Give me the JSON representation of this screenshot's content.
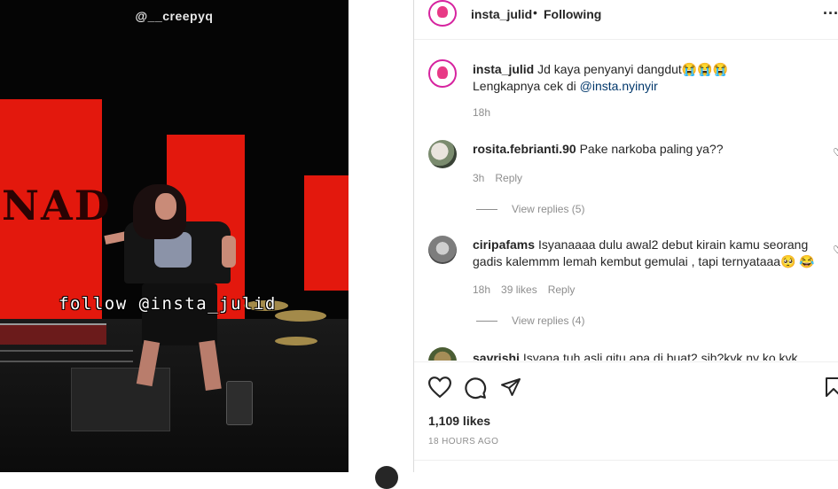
{
  "media": {
    "watermark_top": "@__creepyq",
    "watermark_mid": "follow @insta_julid",
    "banner_text": "NAD"
  },
  "post": {
    "username": "insta_julid",
    "separator": "•",
    "follow_status": "Following",
    "more_label": "..."
  },
  "caption": {
    "username": "insta_julid",
    "text": "Jd kaya penyanyi dangdut😭😭😭",
    "line2_prefix": "Lengkapnya cek di ",
    "mention": "@insta.nyinyir",
    "time": "18h"
  },
  "comments": [
    {
      "username": "rosita.febrianti.90",
      "text": "Pake narkoba paling ya??",
      "time": "3h",
      "reply": "Reply",
      "view_replies": "View replies (5)"
    },
    {
      "username": "ciripafams",
      "text": "Isyanaaaa dulu awal2 debut kirain kamu seorang",
      "text_line2": "gadis kalemmm lemah kembut gemulai , tapi ternyataaa🥺 😂",
      "time": "18h",
      "likes": "39 likes",
      "reply": "Reply",
      "view_replies": "View replies (4)"
    },
    {
      "username": "savrishi",
      "text": "Isyana tuh asli gitu apa di buat2 sih?kyk ny ko kyk"
    }
  ],
  "actions": {
    "like_icon": "heart-icon",
    "comment_icon": "comment-icon",
    "share_icon": "send-icon",
    "save_icon": "bookmark-icon",
    "likes": "1,109 likes",
    "timestamp": "18 HOURS AGO"
  }
}
